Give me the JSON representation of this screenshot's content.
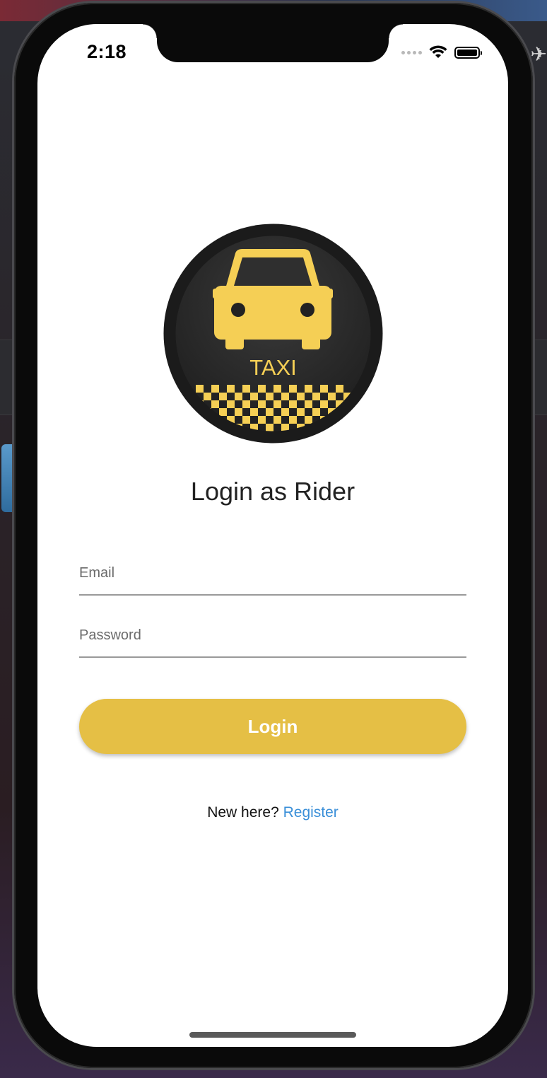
{
  "status_bar": {
    "time": "2:18"
  },
  "logo": {
    "text": "TAXI",
    "icon": "taxi-icon",
    "colors": {
      "yellow": "#f5cf55",
      "dark": "#2b2b2b"
    }
  },
  "page": {
    "title": "Login as Rider"
  },
  "form": {
    "email_placeholder": "Email",
    "email_value": "",
    "password_placeholder": "Password",
    "password_value": ""
  },
  "login_button": {
    "label": "Login",
    "color": "#e5bf45"
  },
  "register": {
    "prompt": "New here?",
    "link_label": "Register",
    "link_color": "#3a8fd8"
  }
}
